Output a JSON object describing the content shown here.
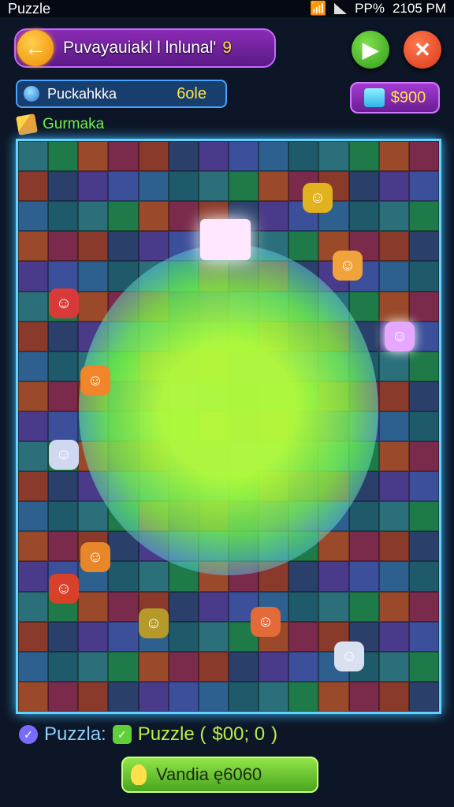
{
  "status_bar": {
    "app": "Puzzle",
    "indicators": "PP%",
    "time": "2105 PM"
  },
  "header": {
    "title": "Puvayauiakl l lnlunal'",
    "level": "9"
  },
  "info_bar": {
    "label": "Puckahkka",
    "value": "6ole"
  },
  "coins": {
    "value": "$900"
  },
  "hint": {
    "label": "Gurmaka"
  },
  "bottom": {
    "label1": "Puzzla:",
    "label2": "Puzzle (",
    "value": "$00; 0",
    "close_paren": ")"
  },
  "action_button": {
    "label": "Vandia ę6060"
  },
  "colors": {
    "board_border": "#5fd4ff",
    "glow": "#b4ff3c",
    "accent": "#ffe34a"
  }
}
